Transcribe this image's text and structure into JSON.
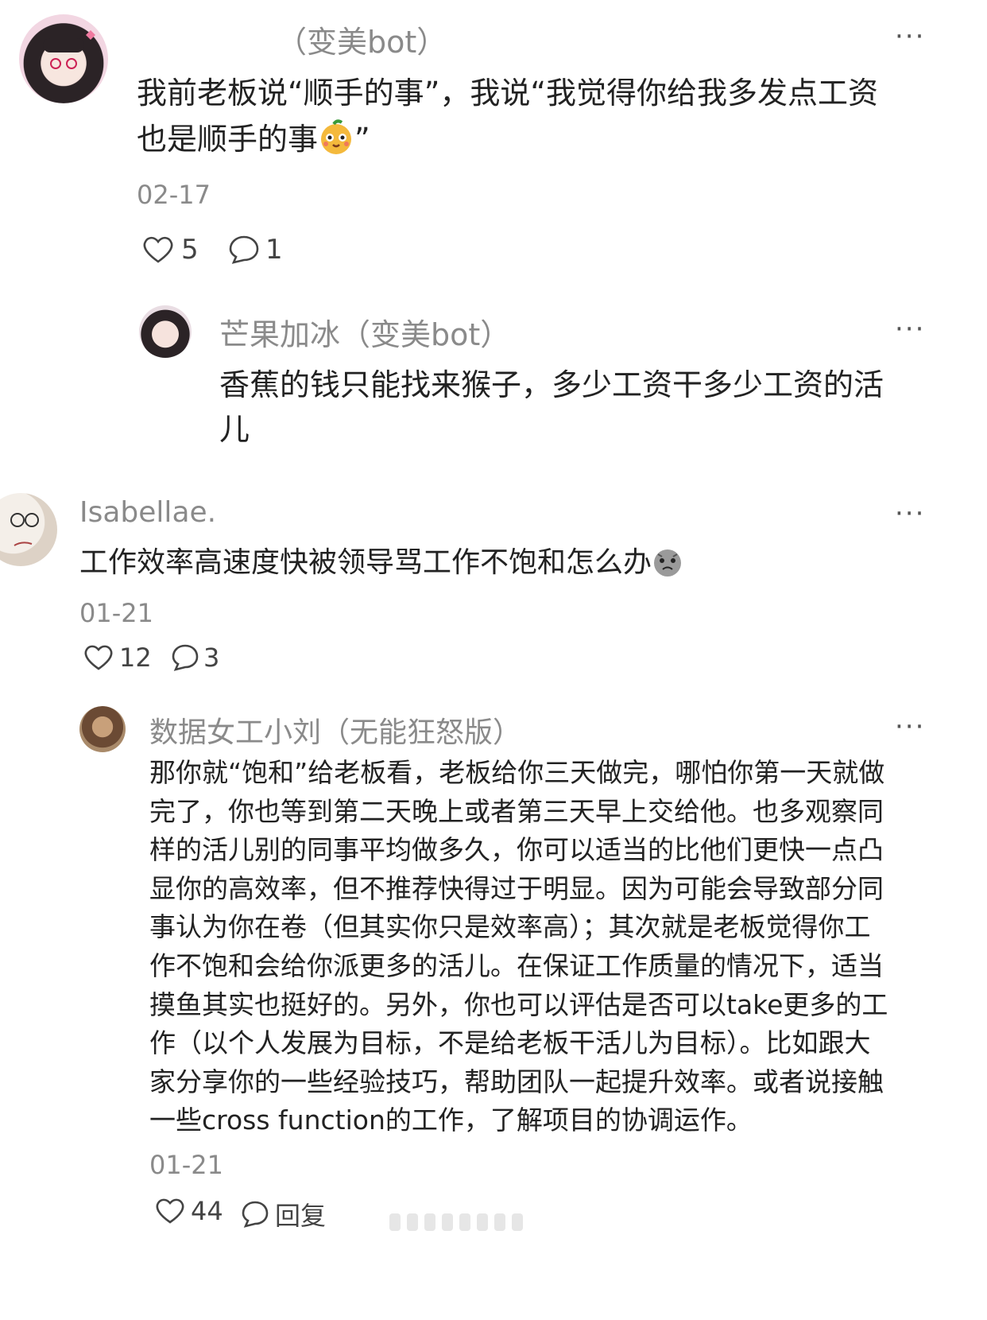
{
  "colors": {
    "text": "#222222",
    "meta": "#8a8a8a",
    "icon": "#444444"
  },
  "comments": [
    {
      "author": "（变美bot）",
      "text_line1": "我前老板说“顺手的事”，我说“我觉得你给我多发点工资",
      "text_line2a": "也是顺手的事",
      "text_line2b": "”",
      "emoji": "mango-face-emoji",
      "date": "02-17",
      "likes": "5",
      "replies": "1",
      "reply": {
        "author": "芒果加冰（变美bot）",
        "text_line1": "香蕉的钱只能找来猴子，多少工资干多少工资的活",
        "text_line2": "儿"
      }
    },
    {
      "author": "Isabellae.",
      "text": "工作效率高速度快被领导骂工作不饱和怎么办",
      "emoji": "crying-face-emoji",
      "date": "01-21",
      "likes": "12",
      "replies": "3",
      "reply": {
        "author": "数据女工小刘（无能狂怒版）",
        "lines": [
          "那你就“饱和”给老板看，老板给你三天做完，哪怕你第一天就做",
          "完了，你也等到第二天晚上或者第三天早上交给他。也多观察同",
          "样的活儿别的同事平均做多久，你可以适当的比他们更快一点凸",
          "显你的高效率，但不推荐快得过于明显。因为可能会导致部分同",
          "事认为你在卷（但其实你只是效率高）；其次就是老板觉得你工",
          "作不饱和会给你派更多的活儿。在保证工作质量的情况下，适当",
          "摸鱼其实也挺好的。另外，你也可以评估是否可以take更多的工",
          "作（以个人发展为目标，不是给老板干活儿为目标）。比如跟大",
          "家分享你的一些经验技巧，帮助团队一起提升效率。或者说接触",
          "一些cross function的工作，了解项目的协调运作。"
        ],
        "date": "01-21",
        "likes": "44",
        "reply_label": "回复"
      }
    }
  ],
  "more_label": "···"
}
